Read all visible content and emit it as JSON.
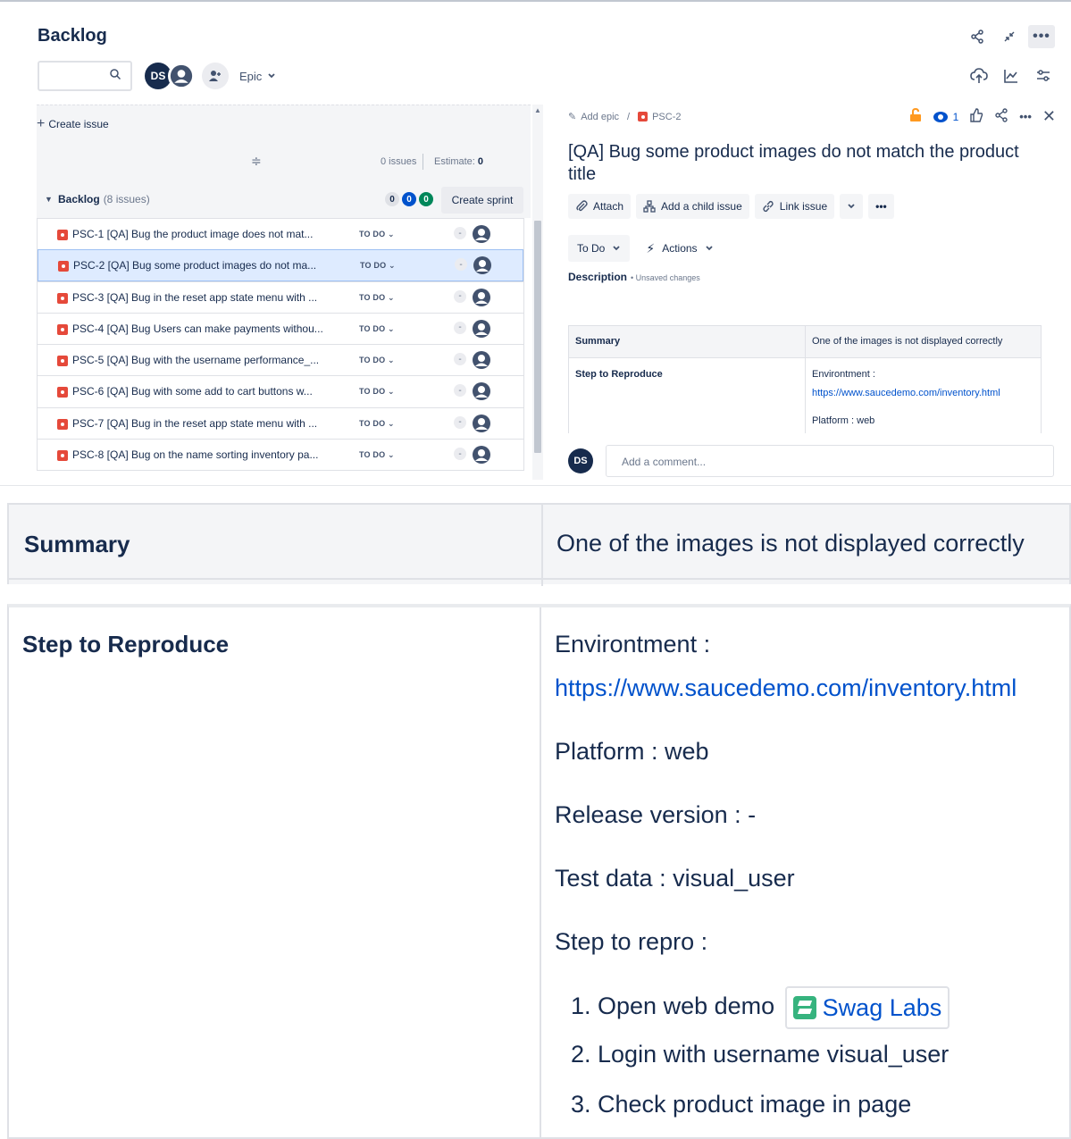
{
  "header": {
    "title": "Backlog",
    "epic_filter": "Epic"
  },
  "avatars": {
    "current_user_initials": "DS"
  },
  "create_issue": "Create issue",
  "estimate_bar": {
    "issues": "0 issues",
    "estimate_label": "Estimate:",
    "estimate_value": "0"
  },
  "backlog": {
    "label": "Backlog",
    "count": "(8 issues)",
    "badges": [
      "0",
      "0",
      "0"
    ],
    "create_sprint": "Create sprint"
  },
  "issues": [
    {
      "title": "PSC-1 [QA] Bug the product image does not mat...",
      "status": "TO DO",
      "estimate": "-"
    },
    {
      "title": "PSC-2 [QA] Bug some product images do not ma...",
      "status": "TO DO",
      "estimate": "-"
    },
    {
      "title": "PSC-3 [QA] Bug in the reset app state menu with ...",
      "status": "TO DO",
      "estimate": "-"
    },
    {
      "title": "PSC-4 [QA] Bug Users can make payments withou...",
      "status": "TO DO",
      "estimate": "-"
    },
    {
      "title": "PSC-5 [QA] Bug with the username performance_...",
      "status": "TO DO",
      "estimate": "-"
    },
    {
      "title": "PSC-6 [QA] Bug with some add to cart buttons w...",
      "status": "TO DO",
      "estimate": "-"
    },
    {
      "title": "PSC-7 [QA] Bug in the reset app state menu with ...",
      "status": "TO DO",
      "estimate": "-"
    },
    {
      "title": "PSC-8 [QA] Bug on the name sorting inventory pa...",
      "status": "TO DO",
      "estimate": "-"
    }
  ],
  "detail": {
    "add_epic": "Add epic",
    "crumb_sep": "/",
    "issue_key": "PSC-2",
    "watch_count": "1",
    "title": "[QA] Bug some product images do not match the product title",
    "buttons": {
      "attach": "Attach",
      "child": "Add a child issue",
      "link": "Link issue"
    },
    "status": "To Do",
    "actions": "Actions",
    "description_label": "Description",
    "unsaved": "• Unsaved changes",
    "table": {
      "summary_label": "Summary",
      "summary_value": "One of the images is not displayed correctly",
      "step_label": "Step to Reproduce",
      "env_label": "Environtment :",
      "env_url": "https://www.saucedemo.com/inventory.html",
      "platform": "Platform : web"
    },
    "comment_placeholder": "Add a comment..."
  },
  "zoom": {
    "summary_label": "Summary",
    "summary_value": "One of the images is not displayed correctly",
    "step_label": "Step to Reproduce",
    "env_label": "Environtment :",
    "env_url": "https://www.saucedemo.com/inventory.html",
    "platform": "Platform : web",
    "release": "Release version : -",
    "test_data": "Test data : visual_user",
    "step_repro": "Step to repro :",
    "steps": [
      "1. Open web demo",
      "2. Login with username visual_user",
      "3. Check product image in page"
    ],
    "swag_label": "Swag Labs"
  }
}
